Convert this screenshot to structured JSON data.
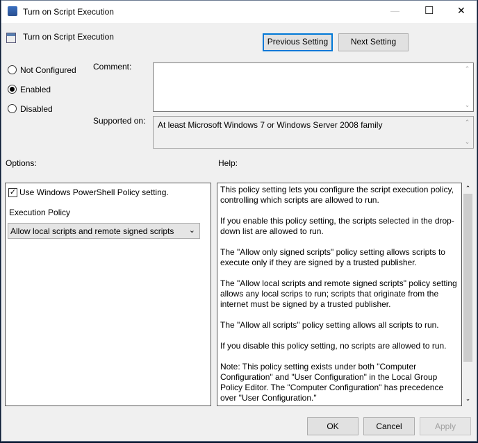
{
  "window": {
    "title": "Turn on Script Execution",
    "controls": [
      "—",
      "☐",
      "✕"
    ]
  },
  "header": {
    "policy_name": "Turn on Script Execution",
    "previous_label": "Previous Setting",
    "next_label": "Next Setting"
  },
  "state": {
    "options": [
      "Not Configured",
      "Enabled",
      "Disabled"
    ],
    "selected": "Enabled"
  },
  "comment": {
    "label": "Comment:",
    "value": ""
  },
  "supported": {
    "label": "Supported on:",
    "value": "At least Microsoft Windows 7 or Windows Server 2008 family"
  },
  "options_panel": {
    "label": "Options:",
    "checkbox_label": "Use Windows PowerShell Policy setting.",
    "checkbox_checked": true,
    "policy_label": "Execution Policy",
    "policy_value": "Allow local scripts and remote signed scripts"
  },
  "help": {
    "label": "Help:",
    "paragraphs": [
      "This policy setting lets you configure the script execution policy, controlling which scripts are allowed to run.",
      "If you enable this policy setting, the scripts selected in the drop-down list are allowed to run.",
      "The \"Allow only signed scripts\" policy setting allows scripts to execute only if they are signed by a trusted publisher.",
      "The \"Allow local scripts and remote signed scripts\" policy setting allows any local scrips to run; scripts that originate from the internet must be signed by a trusted publisher.",
      "The \"Allow all scripts\" policy setting allows all scripts to run.",
      "If you disable this policy setting, no scripts are allowed to run.",
      "Note: This policy setting exists under both \"Computer Configuration\" and \"User Configuration\" in the Local Group Policy Editor. The \"Computer Configuration\" has precedence over \"User Configuration.\""
    ]
  },
  "footer": {
    "ok": "OK",
    "cancel": "Cancel",
    "apply": "Apply"
  },
  "colors": {
    "accent": "#0078d7",
    "background": "#f0f0f0"
  }
}
